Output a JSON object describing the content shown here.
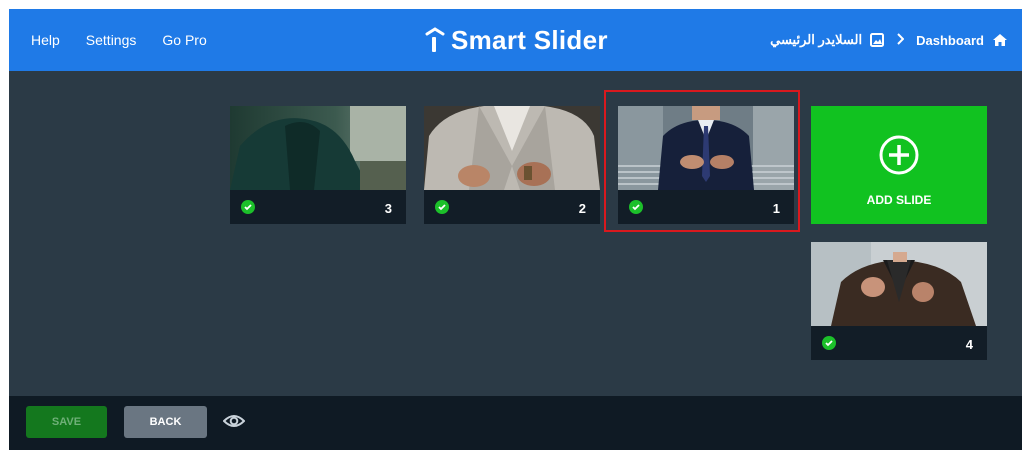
{
  "header": {
    "nav": [
      "Help",
      "Settings",
      "Go Pro"
    ],
    "logo_text": "Smart Slider",
    "breadcrumbs": {
      "current": "السلايدر الرئيسي",
      "root": "Dashboard"
    }
  },
  "slides": [
    {
      "number": "3",
      "published": true
    },
    {
      "number": "2",
      "published": true
    },
    {
      "number": "1",
      "published": true,
      "selected": true
    },
    {
      "number": "4",
      "published": true
    }
  ],
  "add_slide": {
    "label": "ADD SLIDE"
  },
  "footer": {
    "save_label": "SAVE",
    "back_label": "BACK"
  },
  "colors": {
    "header_bg": "#1f7ae7",
    "content_bg": "#2b3a46",
    "footer_bg": "#0f1a24",
    "add_slide_bg": "#11c220",
    "check_green": "#1cc02a",
    "selection_outline": "#d9191e"
  },
  "icons": [
    "home-icon",
    "chevron-right-icon",
    "image-icon",
    "plus-circle-icon",
    "check-icon",
    "eye-icon",
    "logo-icon"
  ]
}
